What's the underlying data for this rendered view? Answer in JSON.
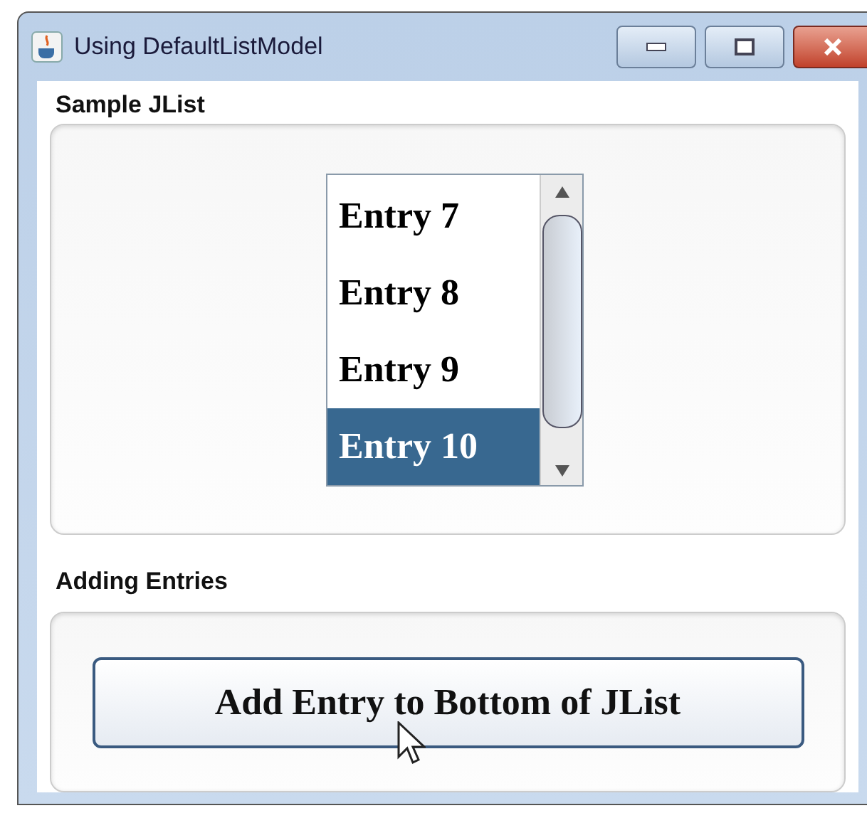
{
  "window": {
    "title": "Using DefaultListModel"
  },
  "list_section": {
    "title": "Sample JList",
    "entries": [
      {
        "label": "Entry 7",
        "selected": false
      },
      {
        "label": "Entry 8",
        "selected": false
      },
      {
        "label": "Entry 9",
        "selected": false
      },
      {
        "label": "Entry 10",
        "selected": true
      }
    ]
  },
  "adding_section": {
    "title": "Adding Entries",
    "button": "Add Entry to Bottom of JList"
  }
}
